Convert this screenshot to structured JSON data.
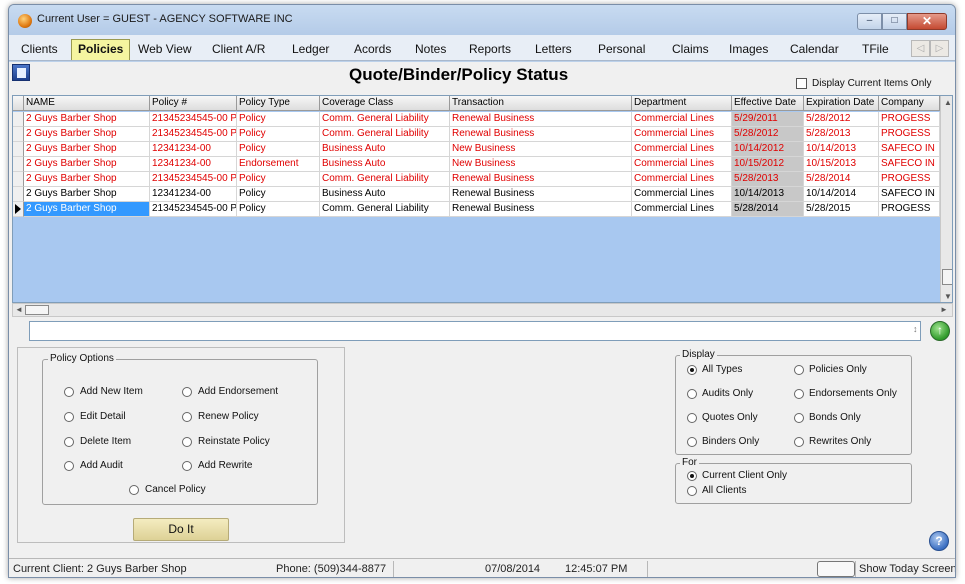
{
  "window": {
    "title": "Current User = GUEST - AGENCY SOFTWARE INC",
    "minimize_glyph": "–",
    "maximize_glyph": "□",
    "close_glyph": "✕"
  },
  "tabs": [
    {
      "label": "Clients"
    },
    {
      "label": "Policies"
    },
    {
      "label": "Web View"
    },
    {
      "label": "Client A/R"
    },
    {
      "label": "Ledger"
    },
    {
      "label": "Acords"
    },
    {
      "label": "Notes"
    },
    {
      "label": "Reports"
    },
    {
      "label": "Letters"
    },
    {
      "label": "Personal"
    },
    {
      "label": "Claims"
    },
    {
      "label": "Images"
    },
    {
      "label": "Calendar"
    },
    {
      "label": "TFile"
    }
  ],
  "active_tab": "Policies",
  "tab_nav": {
    "prev": "◁",
    "next": "▷"
  },
  "page": {
    "title": "Quote/Binder/Policy Status",
    "display_current_label": "Display Current Items Only",
    "display_current_checked": false
  },
  "grid": {
    "headers": [
      "NAME",
      "Policy #",
      "Policy Type",
      "Coverage Class",
      "Transaction",
      "Department",
      "Effective Date",
      "Expiration Date",
      "Company"
    ],
    "rows": [
      {
        "name": "2 Guys Barber Shop",
        "policy": "21345234545-00 P",
        "type": "Policy",
        "coverage": "Comm. General Liability",
        "transaction": "Renewal Business",
        "department": "Commercial Lines",
        "effective": "5/29/2011",
        "expiration": "5/28/2012",
        "company": "PROGESS",
        "expired": true
      },
      {
        "name": "2 Guys Barber Shop",
        "policy": "21345234545-00 P",
        "type": "Policy",
        "coverage": "Comm. General Liability",
        "transaction": "Renewal Business",
        "department": "Commercial Lines",
        "effective": "5/28/2012",
        "expiration": "5/28/2013",
        "company": "PROGESS",
        "expired": true
      },
      {
        "name": "2 Guys Barber Shop",
        "policy": "12341234-00",
        "type": "Policy",
        "coverage": "Business Auto",
        "transaction": "New Business",
        "department": "Commercial Lines",
        "effective": "10/14/2012",
        "expiration": "10/14/2013",
        "company": "SAFECO IN",
        "expired": true
      },
      {
        "name": "2 Guys Barber Shop",
        "policy": "12341234-00",
        "type": "Endorsement",
        "coverage": "Business Auto",
        "transaction": "New Business",
        "department": "Commercial Lines",
        "effective": "10/15/2012",
        "expiration": "10/15/2013",
        "company": "SAFECO IN",
        "expired": true
      },
      {
        "name": "2 Guys Barber Shop",
        "policy": "21345234545-00 P",
        "type": "Policy",
        "coverage": "Comm. General Liability",
        "transaction": "Renewal Business",
        "department": "Commercial Lines",
        "effective": "5/28/2013",
        "expiration": "5/28/2014",
        "company": "PROGESS",
        "expired": true
      },
      {
        "name": "2 Guys Barber Shop",
        "policy": "12341234-00",
        "type": "Policy",
        "coverage": "Business Auto",
        "transaction": "Renewal Business",
        "department": "Commercial Lines",
        "effective": "10/14/2013",
        "expiration": "10/14/2014",
        "company": "SAFECO IN",
        "expired": false
      },
      {
        "name": "2 Guys Barber Shop",
        "policy": "21345234545-00 P",
        "type": "Policy",
        "coverage": "Comm. General Liability",
        "transaction": "Renewal Business",
        "department": "Commercial Lines",
        "effective": "5/28/2014",
        "expiration": "5/28/2015",
        "company": "PROGESS",
        "expired": false,
        "selected": true
      }
    ]
  },
  "scroll_glyphs": {
    "up": "▲",
    "down": "▼",
    "left": "◄",
    "right": "►",
    "spin": "↕"
  },
  "go_glyph": "↑",
  "policy_options": {
    "legend": "Policy Options",
    "items": [
      "Add New Item",
      "Add Endorsement",
      "Edit Detail",
      "Renew Policy",
      "Delete Item",
      "Reinstate Policy",
      "Add Audit",
      "Add Rewrite",
      "Cancel Policy"
    ],
    "do_it_label": "Do It"
  },
  "display_options": {
    "legend": "Display",
    "items": [
      "All Types",
      "Policies Only",
      "Audits Only",
      "Endorsements Only",
      "Quotes Only",
      "Bonds Only",
      "Binders Only",
      "Rewrites Only"
    ],
    "selected": "All Types"
  },
  "for_options": {
    "legend": "For",
    "items": [
      "Current Client Only",
      "All Clients"
    ],
    "selected": "Current Client Only"
  },
  "help_glyph": "?",
  "status": {
    "current_client": "Current Client: 2 Guys Barber Shop",
    "phone": "Phone: (509)344-8877",
    "date": "07/08/2014",
    "time": "12:45:07 PM",
    "show_today": "Show Today Screen"
  },
  "colors": {
    "expired_text": "#e00000",
    "selected_row": "#3399ff",
    "active_tab": "#f5f5a0",
    "grid_background": "#a8c8f0"
  }
}
